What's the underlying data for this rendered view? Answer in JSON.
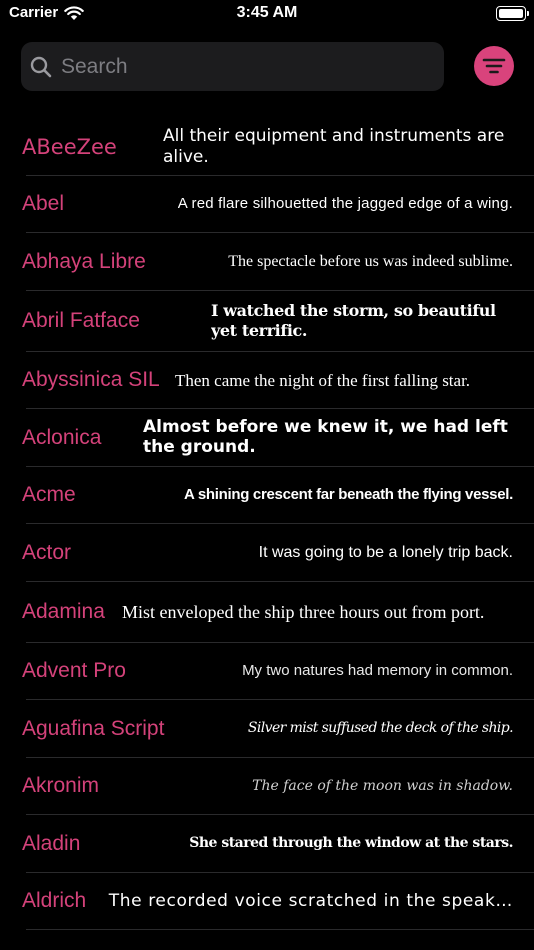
{
  "status_bar": {
    "carrier": "Carrier",
    "time": "3:45 AM"
  },
  "search": {
    "placeholder": "Search",
    "value": ""
  },
  "colors": {
    "accent": "#d9437c",
    "font_name": "#d4427a",
    "search_bg": "#1c1c1e",
    "background": "#000000"
  },
  "icons": {
    "search": "search-icon",
    "filter": "filter-icon",
    "wifi": "wifi-icon",
    "battery": "battery-icon"
  },
  "fonts": [
    {
      "name": "ABeeZee",
      "sample": "All their equipment and instruments are alive."
    },
    {
      "name": "Abel",
      "sample": "A red flare silhouetted the jagged edge of a wing."
    },
    {
      "name": "Abhaya Libre",
      "sample": "The spectacle before us was indeed sublime."
    },
    {
      "name": "Abril Fatface",
      "sample": "I watched the storm, so beautiful yet terrific."
    },
    {
      "name": "Abyssinica SIL",
      "sample": "Then came the night of the first falling star."
    },
    {
      "name": "Aclonica",
      "sample": "Almost before we knew it, we had left the ground."
    },
    {
      "name": "Acme",
      "sample": "A shining crescent far beneath the flying vessel."
    },
    {
      "name": "Actor",
      "sample": "It was going to be a lonely trip back."
    },
    {
      "name": "Adamina",
      "sample": "Mist enveloped the ship three hours out from port."
    },
    {
      "name": "Advent Pro",
      "sample": "My two natures had memory in common."
    },
    {
      "name": "Aguafina Script",
      "sample": "Silver mist suffused the deck of the ship."
    },
    {
      "name": "Akronim",
      "sample": "The face of the moon was in shadow."
    },
    {
      "name": "Aladin",
      "sample": "She stared through the window at the stars."
    },
    {
      "name": "Aldrich",
      "sample": "The recorded voice scratched in the speak…"
    }
  ]
}
